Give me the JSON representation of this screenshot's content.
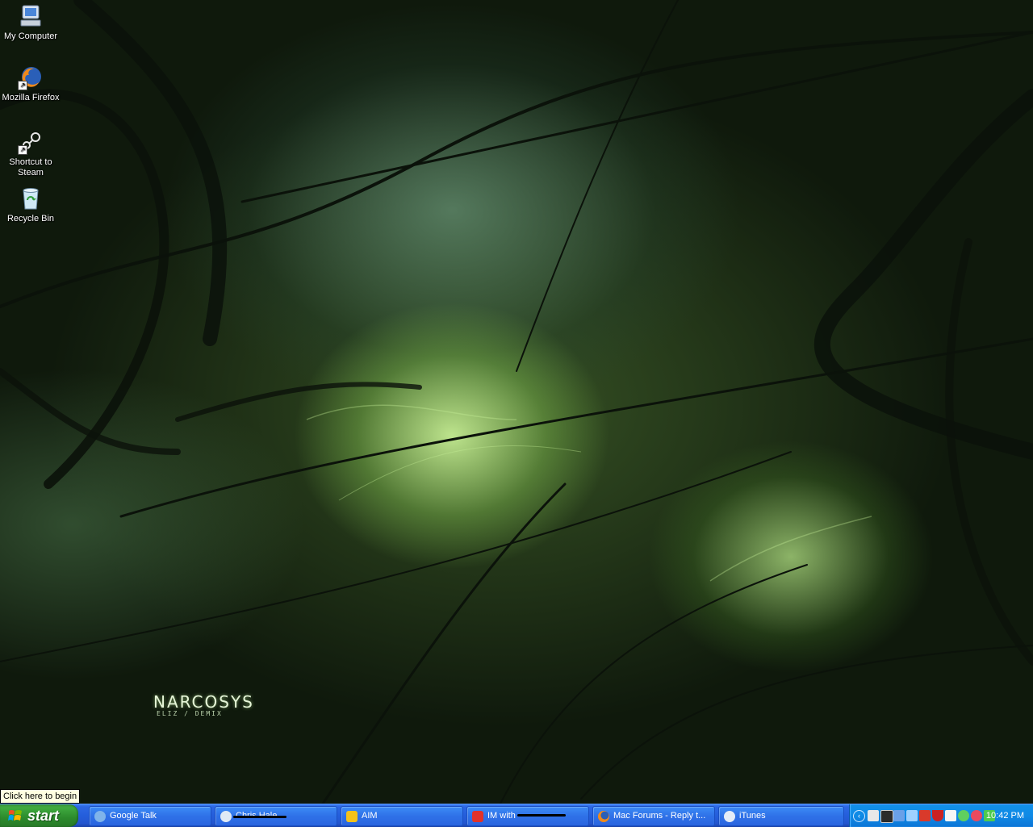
{
  "desktop": {
    "icons": [
      {
        "label": "My Computer"
      },
      {
        "label": "Mozilla Firefox"
      },
      {
        "label": "Shortcut to Steam"
      },
      {
        "label": "Recycle Bin"
      }
    ],
    "wallpaper_title": "NARCOSYS",
    "wallpaper_subtitle": "ELIZ / DEMIX"
  },
  "tooltip": "Click here to begin",
  "taskbar": {
    "start_label": "start",
    "buttons": [
      {
        "label": "Google Talk",
        "icon": "google-talk-icon"
      },
      {
        "label": "Chris Hale",
        "icon": "chat-bubble-icon"
      },
      {
        "label": "AIM",
        "icon": "aim-icon"
      },
      {
        "label": "IM with",
        "icon": "aim-icon"
      },
      {
        "label": "Mac Forums - Reply t...",
        "icon": "firefox-icon"
      },
      {
        "label": "iTunes",
        "icon": "itunes-icon"
      }
    ],
    "clock": "10:42 PM"
  },
  "colors": {
    "taskbar_blue": "#245edb",
    "start_green": "#3faa3f",
    "tray_blue": "#0f8ae6"
  }
}
